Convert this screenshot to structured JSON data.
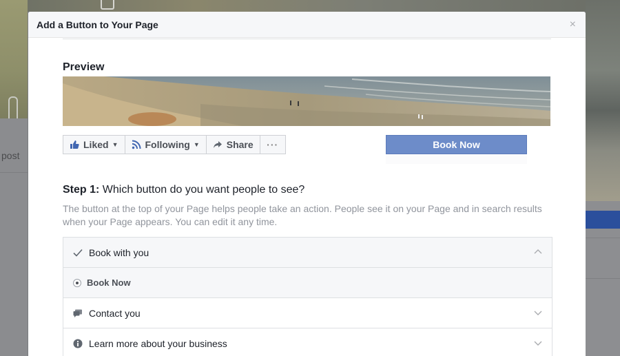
{
  "background": {
    "left_text": "post"
  },
  "modal": {
    "title": "Add a Button to Your Page",
    "close_glyph": "×"
  },
  "preview": {
    "section_title": "Preview",
    "actions": {
      "liked_label": "Liked",
      "following_label": "Following",
      "share_label": "Share",
      "more_glyph": "···"
    },
    "cta_label": "Book Now"
  },
  "step1": {
    "prefix": "Step 1:",
    "question": "Which button do you want people to see?",
    "description": "The button at the top of your Page helps people take an action. People see it on your Page and in search results when your Page appears. You can edit it any time."
  },
  "options": [
    {
      "label": "Book with you",
      "icon": "check-icon",
      "state": "expanded"
    },
    {
      "label": "Book Now",
      "icon": "radio-icon",
      "state": "selected-sub"
    },
    {
      "label": "Contact you",
      "icon": "chat-icon",
      "state": "collapsed"
    },
    {
      "label": "Learn more about your business",
      "icon": "info-icon",
      "state": "collapsed"
    }
  ],
  "colors": {
    "cta_button": "#6d8cc9",
    "header_bg": "#f6f7f9",
    "dim_overlay": "#7a7c80"
  }
}
